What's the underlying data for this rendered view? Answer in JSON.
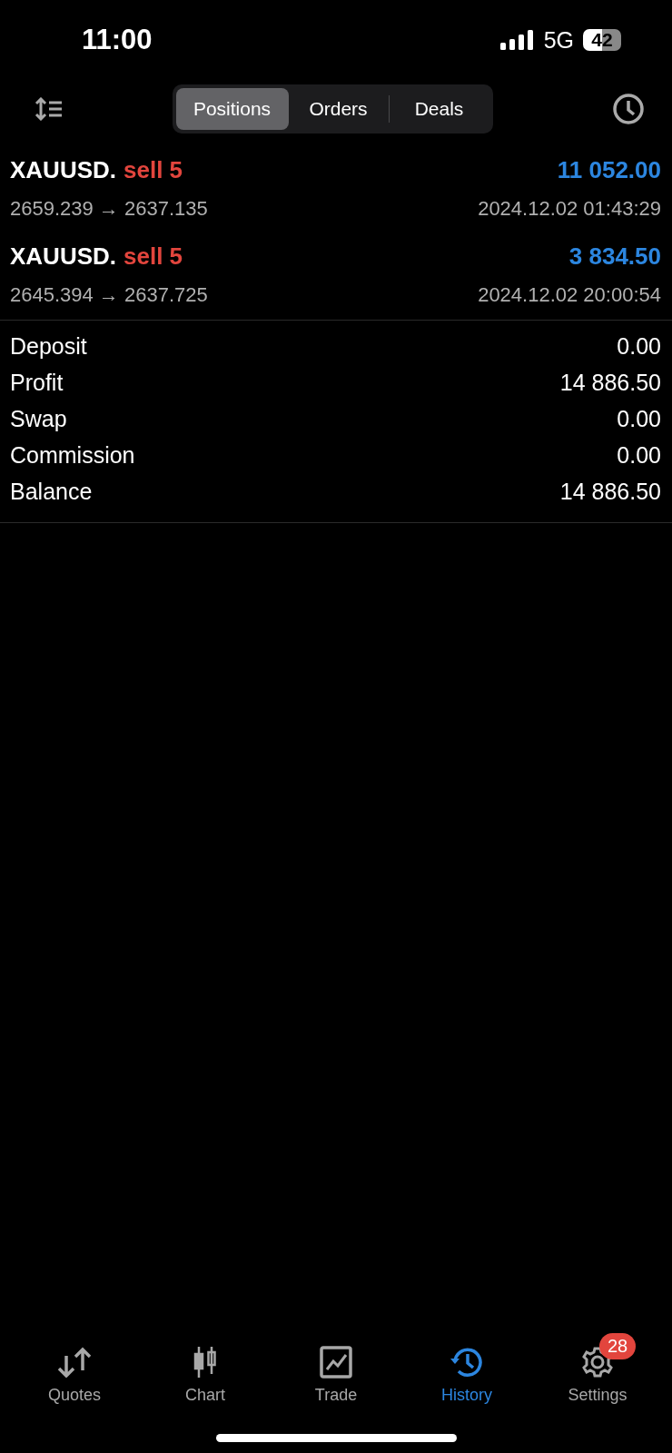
{
  "status_bar": {
    "time": "11:00",
    "network": "5G",
    "battery": "42"
  },
  "segments": [
    {
      "label": "Positions",
      "selected": true
    },
    {
      "label": "Orders",
      "selected": false
    },
    {
      "label": "Deals",
      "selected": false
    }
  ],
  "positions": [
    {
      "symbol": "XAUUSD.",
      "side": "sell 5",
      "profit": "11 052.00",
      "prices": "2659.239 → 2637.135",
      "time": "2024.12.02 01:43:29"
    },
    {
      "symbol": "XAUUSD.",
      "side": "sell 5",
      "profit": "3 834.50",
      "prices": "2645.394 → 2637.725",
      "time": "2024.12.02 20:00:54"
    }
  ],
  "summary": [
    {
      "label": "Deposit",
      "value": "0.00"
    },
    {
      "label": "Profit",
      "value": "14 886.50"
    },
    {
      "label": "Swap",
      "value": "0.00"
    },
    {
      "label": "Commission",
      "value": "0.00"
    },
    {
      "label": "Balance",
      "value": "14 886.50"
    }
  ],
  "tab_bar": [
    {
      "kind": "quotes",
      "label": "Quotes",
      "selected": false
    },
    {
      "kind": "chart",
      "label": "Chart",
      "selected": false
    },
    {
      "kind": "trade",
      "label": "Trade",
      "selected": false
    },
    {
      "kind": "history",
      "label": "History",
      "selected": true
    },
    {
      "kind": "settings",
      "label": "Settings",
      "selected": false,
      "badge": "28"
    }
  ]
}
